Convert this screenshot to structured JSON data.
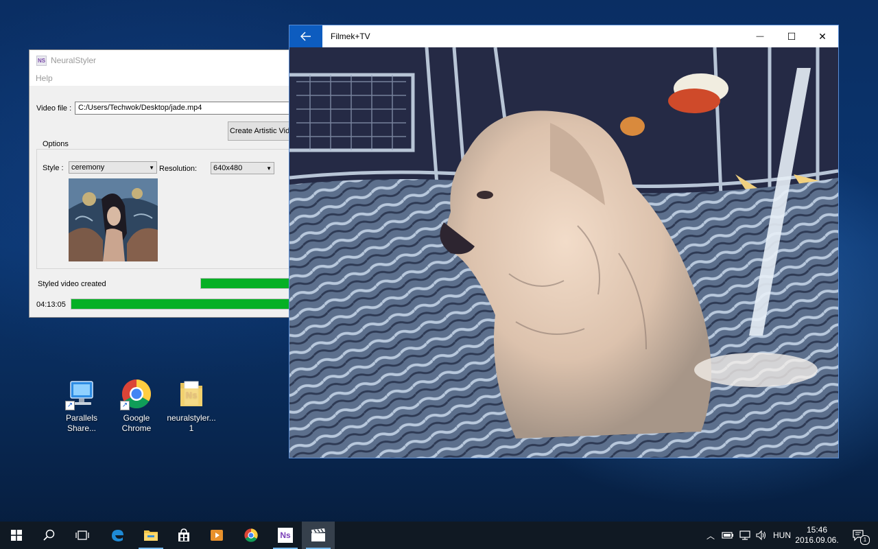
{
  "neuralstyler": {
    "title": "NeuralStyler",
    "logo": "NS",
    "menu": [
      "Help"
    ],
    "video_file_label": "Video file :",
    "video_file_value": "C:/Users/Techwok/Desktop/jade.mp4",
    "create_button": "Create Artistic Video",
    "options_label": "Options",
    "style_label": "Style :",
    "style_value": "ceremony",
    "resolution_label": "Resolution:",
    "resolution_value": "640x480",
    "status_text": "Styled video created",
    "status_progress": 1.0,
    "elapsed_time": "04:13:05",
    "elapsed_progress": 1.0
  },
  "film_tv": {
    "title": "Filmek+TV",
    "back_icon": "back-arrow-icon",
    "minimize_glyph": "—",
    "maximize_glyph": "☐",
    "close_glyph": "✕"
  },
  "desktop_icons": [
    {
      "line1": "Parallels",
      "line2": "Share...",
      "icon": "parallels-share-icon"
    },
    {
      "line1": "Google",
      "line2": "Chrome",
      "icon": "chrome-icon"
    },
    {
      "line1": "neuralstyler...",
      "line2": "1",
      "icon": "folder-icon"
    }
  ],
  "taskbar": {
    "language": "HUN",
    "time": "15:46",
    "date": "2016.09.06.",
    "notification_count": "1",
    "ns_label": "Ns"
  }
}
